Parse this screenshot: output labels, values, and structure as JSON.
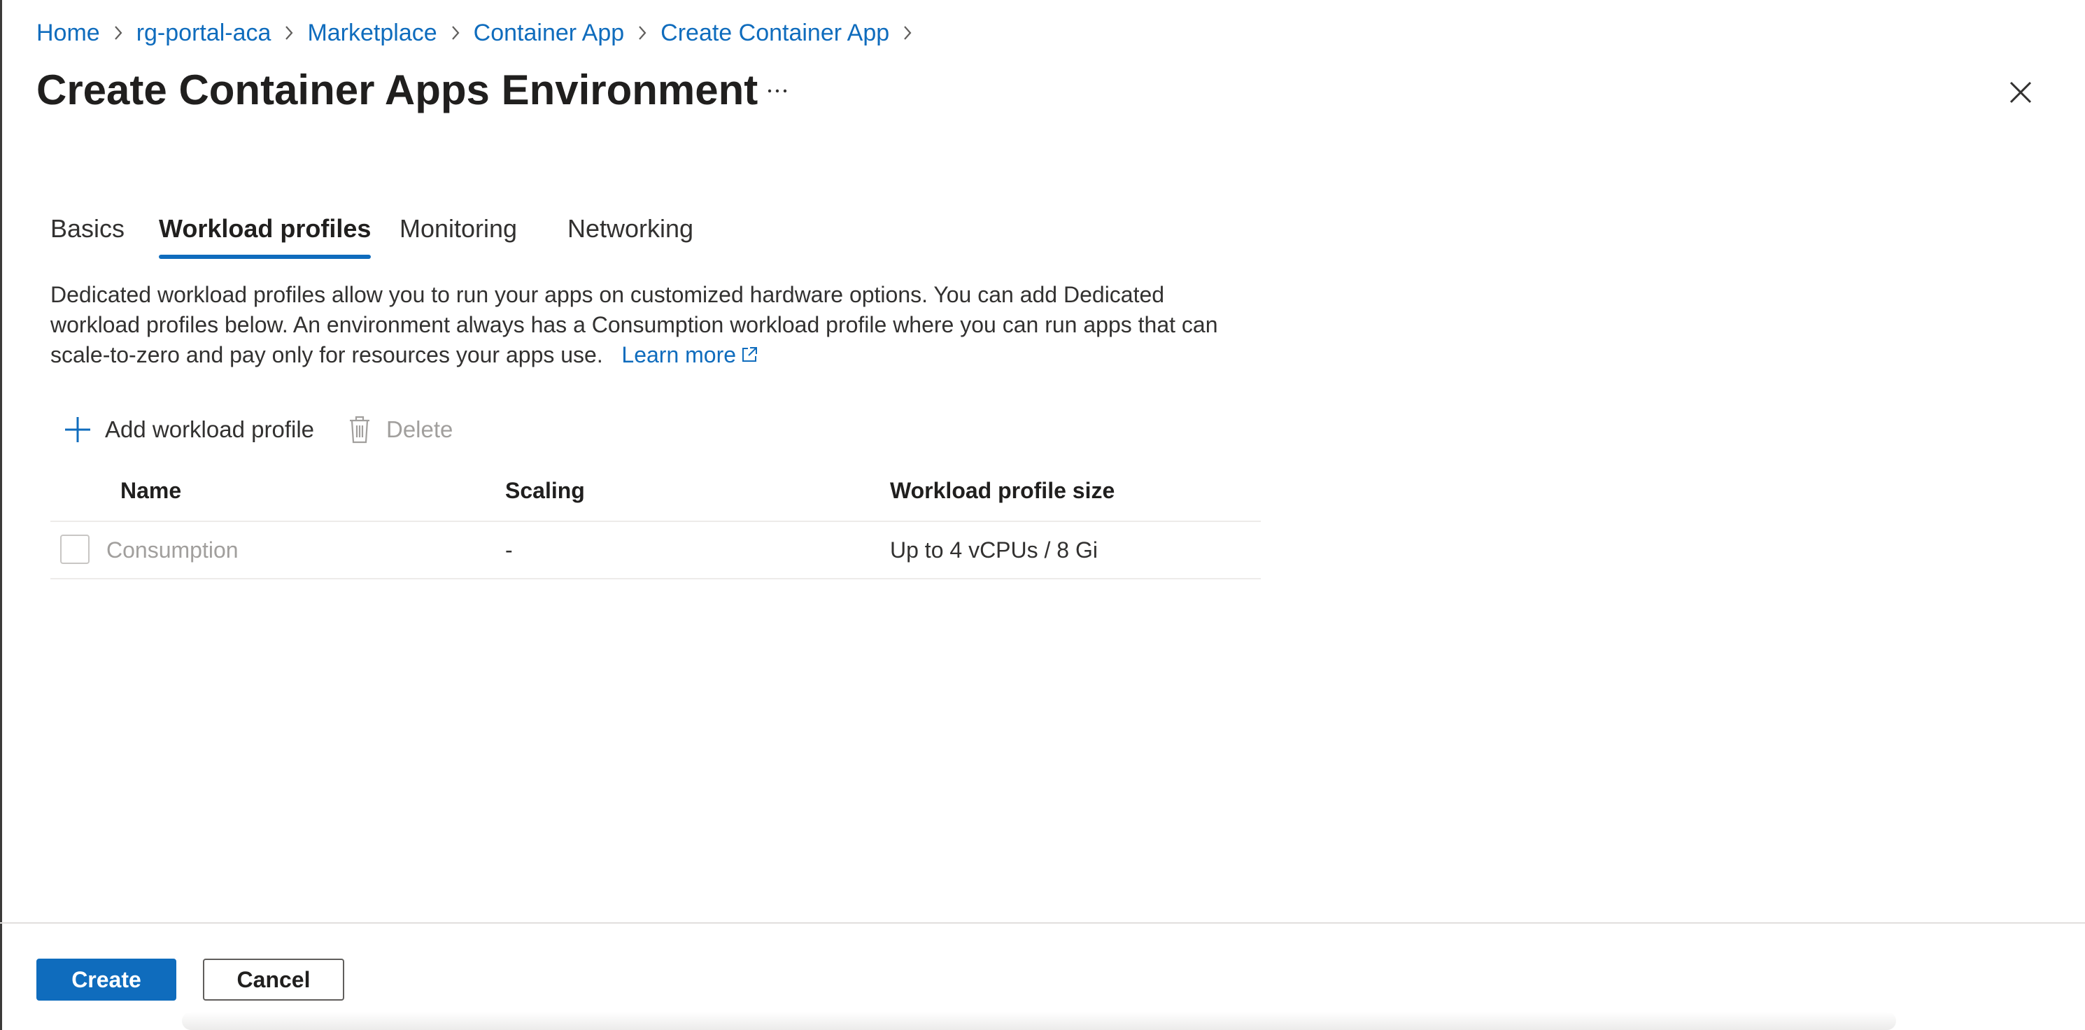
{
  "breadcrumb": [
    "Home",
    "rg-portal-aca",
    "Marketplace",
    "Container App",
    "Create Container App"
  ],
  "title": "Create Container Apps Environment",
  "more_label": "...",
  "tabs": [
    "Basics",
    "Workload profiles",
    "Monitoring",
    "Networking"
  ],
  "active_tab": "Workload profiles",
  "description": {
    "line1": "Dedicated workload profiles allow you to run your apps on customized hardware options. You can add Dedicated",
    "line2": "workload profiles below. An environment always has a Consumption workload profile where you can run apps that can",
    "line3": "scale-to-zero and pay only for resources your apps use.",
    "learn_more": "Learn more"
  },
  "commands": {
    "add": "Add workload profile",
    "delete": "Delete"
  },
  "table": {
    "columns": [
      "Name",
      "Scaling",
      "Workload profile size"
    ],
    "rows": [
      {
        "name": "Consumption",
        "scaling": "-",
        "size": "Up to 4 vCPUs / 8 Gi"
      }
    ]
  },
  "footer": {
    "create": "Create",
    "cancel": "Cancel"
  },
  "colors": {
    "accent": "#0f6cbd",
    "text": "#323130",
    "disabled": "#a19f9d",
    "border": "#edebe9"
  },
  "icons": [
    "chevron-right-icon",
    "more-icon",
    "close-icon",
    "external-link-icon",
    "add-icon",
    "delete-icon"
  ]
}
